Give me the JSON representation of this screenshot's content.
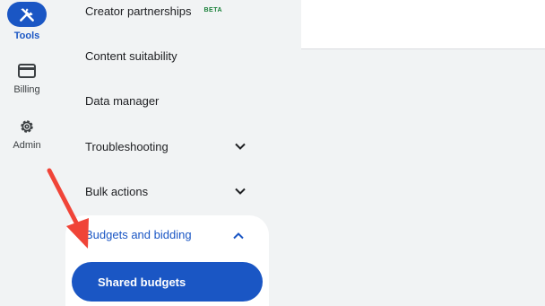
{
  "rail": {
    "tools": {
      "label": "Tools",
      "icon": "tools-icon"
    },
    "billing": {
      "label": "Billing",
      "icon": "billing-card-icon"
    },
    "admin": {
      "label": "Admin",
      "icon": "gear-icon"
    }
  },
  "menu": {
    "creator_partnerships": {
      "label": "Creator partnerships",
      "badge": "BETA"
    },
    "content_suitability": {
      "label": "Content suitability"
    },
    "data_manager": {
      "label": "Data manager"
    },
    "troubleshooting": {
      "label": "Troubleshooting",
      "icon": "chevron-down-icon"
    },
    "bulk_actions": {
      "label": "Bulk actions",
      "icon": "chevron-down-icon"
    },
    "budgets_and_bidding": {
      "label": "Budgets and bidding",
      "icon": "chevron-up-icon",
      "items": [
        {
          "label": "Shared budgets",
          "selected": true
        }
      ]
    }
  },
  "colors": {
    "accent": "#1a56c4",
    "beta": "#188038",
    "annotation_arrow": "#f04438"
  }
}
